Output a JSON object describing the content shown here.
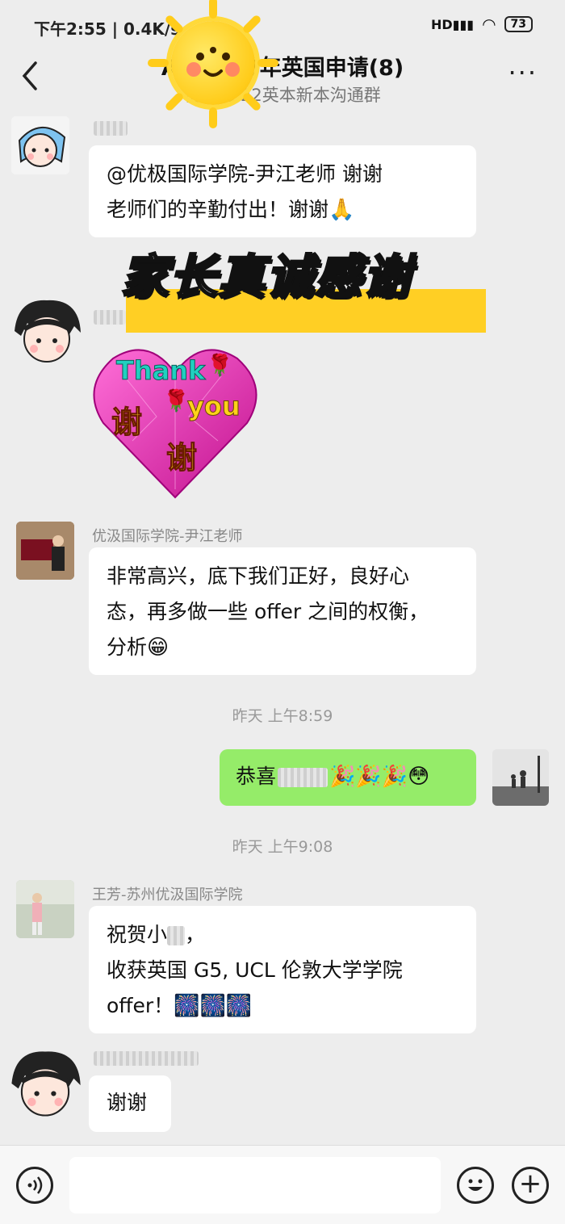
{
  "status": {
    "time": "下午2:55 | 0.4K/s",
    "battery": "73"
  },
  "header": {
    "title": "A留学 22年英国申请(8)",
    "subtitle": "优汲国 22英本新本沟通群"
  },
  "banner": {
    "text": "家长真诚感谢"
  },
  "sticker": {
    "text_en1": "Thank",
    "text_en2": "you",
    "text_cn1": "谢",
    "text_cn2": "谢"
  },
  "messages": [
    {
      "id": "m1",
      "text_line1": "@优极国际学院-尹江老师   谢谢",
      "text_line2": "老师们的辛勤付出！谢谢",
      "emoji": "🙏"
    },
    {
      "id": "m3",
      "sender": "优汲国际学院-尹江老师",
      "text_line1": "非常高兴，底下我们正好，良好心",
      "text_line2": "态，再多做一些 offer 之间的权衡，",
      "text_line3": "分析",
      "emoji": "😁"
    },
    {
      "id": "m4",
      "text_prefix": "恭喜",
      "emoji": "🎉🎉🎉😳"
    },
    {
      "id": "m5",
      "sender": "王芳-苏州优汲国际学院",
      "text_line1_prefix": "祝贺小",
      "text_line1_suffix": "，",
      "text_line2": "收获英国 G5, UCL 伦敦大学学院",
      "text_line3": "offer！",
      "emoji": "🎆🎆🎆"
    },
    {
      "id": "m6",
      "text": "谢谢"
    }
  ],
  "timestamps": {
    "t1": "昨天 上午8:59",
    "t2": "昨天 上午9:08"
  },
  "colors": {
    "outgoing_bubble": "#95ec69",
    "banner_yellow": "#ffcf24",
    "bg": "#ededed"
  },
  "icons": [
    "back-arrow-icon",
    "more-dots-icon",
    "voice-icon",
    "emoji-icon",
    "plus-icon"
  ]
}
